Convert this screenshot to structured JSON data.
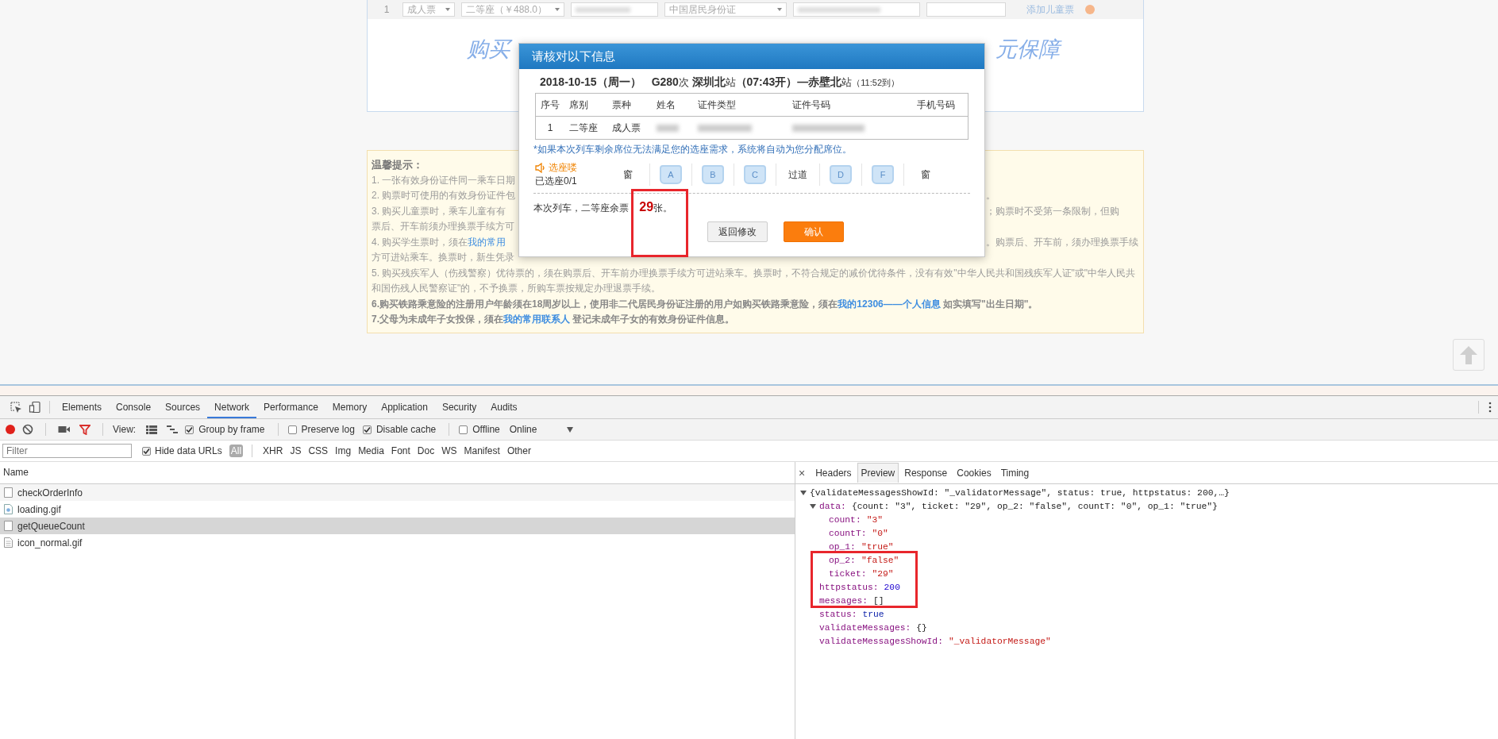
{
  "page": {
    "passenger_row": {
      "index": "1",
      "ticket_type": "成人票",
      "seat_class": "二等座（￥488.0）",
      "id_type": "中国居民身份证",
      "add_child": "添加儿童票"
    },
    "banner": {
      "left": "购买",
      "right": "元保障"
    },
    "tips": {
      "title": "温馨提示：",
      "lines": [
        {
          "kind": "split",
          "left": [
            {
              "text": "1. 一张有效身份证件同一乘车日期"
            }
          ]
        },
        {
          "kind": "split",
          "left": [
            {
              "text": "2. 购票时可使用的有效身份证件包"
            }
          ],
          "right": "。"
        },
        {
          "kind": "split",
          "left": [
            {
              "text": "3. 购买儿童票时，乘车儿童有有"
            }
          ],
          "right": "；购票时不受第一条限制，但购"
        },
        {
          "kind": "split",
          "left": [
            {
              "text": "票后、开车前须办理换票手续方可"
            }
          ]
        },
        {
          "kind": "split",
          "left": [
            {
              "text": "4. 购买学生票时，须在"
            },
            {
              "text": "我的常用",
              "link": true
            }
          ],
          "right": "。购票后、开车前，须办理换票手续"
        },
        {
          "kind": "para",
          "bold": false,
          "segments": [
            {
              "text": "方可进站乘车。换票时，新生凭录"
            }
          ]
        },
        {
          "kind": "para",
          "bold": false,
          "segments": [
            {
              "text": "5. 购买残疾军人（伤残警察）优待票的，须在购票后、开车前办理换票手续方可进站乘车。换票时，不符合规定的减价优待条件，没有有效\"中华人民共和国残疾军人证\"或\"中华人民共和国伤残人民警察证\"的，不予换票，所购车票按规定办理退票手续。"
            }
          ]
        },
        {
          "kind": "para",
          "bold": true,
          "segments": [
            {
              "text": "6.购买铁路乘意险的注册用户年龄须在18周岁以上，使用非二代居民身份证注册的用户如购买铁路乘意险，须在"
            },
            {
              "text": "我的12306——个人信息",
              "link": true
            },
            {
              "text": " 如实填写\"出生日期\"。"
            }
          ]
        },
        {
          "kind": "para",
          "bold": true,
          "segments": [
            {
              "text": "7.父母为未成年子女投保，须在"
            },
            {
              "text": "我的常用联系人",
              "link": true
            },
            {
              "text": " 登记未成年子女的有效身份证件信息。"
            }
          ]
        }
      ]
    }
  },
  "dialog": {
    "title": "请核对以下信息",
    "train": "**2018-10-15（周一）**　**G280**次 **深圳北**站**（07:43开）—赤壁北**站",
    "arrival": "（11:52到）",
    "columns": [
      "序号",
      "席别",
      "票种",
      "姓名",
      "证件类型",
      "证件号码",
      "手机号码"
    ],
    "rows": [
      {
        "cells": [
          {
            "kind": "text",
            "text": "1"
          },
          {
            "kind": "text",
            "text": "二等座"
          },
          {
            "kind": "text",
            "text": "成人票"
          },
          {
            "kind": "blurred"
          },
          {
            "kind": "blurred"
          },
          {
            "kind": "blurred"
          }
        ]
      }
    ],
    "note": "*如果本次列车剩余席位无法满足您的选座需求，系统将自动为您分配席位。",
    "seat_pick": {
      "label": "选座喽",
      "count": "已选座0/1",
      "seats": [
        {
          "kind": "label",
          "text": "窗"
        },
        {
          "kind": "seat",
          "text": "A",
          "selected": false
        },
        {
          "kind": "seat",
          "text": "B",
          "selected": false
        },
        {
          "kind": "seat",
          "text": "C",
          "selected": false
        },
        {
          "kind": "label",
          "text": "过道"
        },
        {
          "kind": "seat",
          "text": "D",
          "selected": false
        },
        {
          "kind": "seat",
          "text": "F",
          "selected": false
        },
        {
          "kind": "label",
          "text": "窗"
        }
      ]
    },
    "remaining": "本次列车，二等座余票 **29**张。",
    "buttons": [
      {
        "kind": "secondary",
        "label": "返回修改"
      },
      {
        "kind": "primary",
        "label": "确认"
      }
    ]
  },
  "devtools": {
    "tabs": [
      {
        "label": "Elements",
        "selected": false
      },
      {
        "label": "Console",
        "selected": false
      },
      {
        "label": "Sources",
        "selected": false
      },
      {
        "label": "Network",
        "selected": true
      },
      {
        "label": "Performance",
        "selected": false
      },
      {
        "label": "Memory",
        "selected": false
      },
      {
        "label": "Application",
        "selected": false
      },
      {
        "label": "Security",
        "selected": false
      },
      {
        "label": "Audits",
        "selected": false
      }
    ],
    "recording": true,
    "filter_shown": true,
    "view_label": "View:",
    "options": [
      {
        "label": "Group by frame",
        "checked": true
      },
      {
        "label": "Preserve log",
        "checked": false
      },
      {
        "label": "Disable cache",
        "checked": true
      },
      {
        "label": "Offline",
        "checked": false
      }
    ],
    "throttle": "Online",
    "filter": {
      "placeholder": "Filter"
    },
    "hide_data_urls": {
      "label": "Hide data URLs",
      "checked": true
    },
    "types": [
      {
        "label": "All",
        "selected": true
      },
      {
        "label": "XHR",
        "selected": false
      },
      {
        "label": "JS",
        "selected": false
      },
      {
        "label": "CSS",
        "selected": false
      },
      {
        "label": "Img",
        "selected": false
      },
      {
        "label": "Media",
        "selected": false
      },
      {
        "label": "Font",
        "selected": false
      },
      {
        "label": "Doc",
        "selected": false
      },
      {
        "label": "WS",
        "selected": false
      },
      {
        "label": "Manifest",
        "selected": false
      },
      {
        "label": "Other",
        "selected": false
      }
    ],
    "column": "Name",
    "requests": [
      {
        "name": "checkOrderInfo",
        "kind": "document",
        "selected": false
      },
      {
        "name": "loading.gif",
        "kind": "image",
        "selected": false
      },
      {
        "name": "getQueueCount",
        "kind": "document",
        "selected": true
      },
      {
        "name": "icon_normal.gif",
        "kind": "file",
        "selected": false
      }
    ],
    "close": "×",
    "detail_tabs": [
      {
        "label": "Headers",
        "selected": false
      },
      {
        "label": "Preview",
        "selected": true
      },
      {
        "label": "Response",
        "selected": false
      },
      {
        "label": "Cookies",
        "selected": false
      },
      {
        "label": "Timing",
        "selected": false
      }
    ],
    "tree": [
      {
        "value": "{validateMessagesShowId: \"_validatorMessage\", status: true, httpstatus: 200,…}",
        "kind": "summary",
        "expanded": true,
        "children": [
          {
            "key": "data:",
            "value": "{count: \"3\", ticket: \"29\", op_2: \"false\", countT: \"0\", op_1: \"true\"}",
            "kind": "summary",
            "expanded": true,
            "children": [
              {
                "key": "count:",
                "value": "\"3\"",
                "kind": "string"
              },
              {
                "key": "countT:",
                "value": "\"0\"",
                "kind": "string"
              },
              {
                "key": "op_1:",
                "value": "\"true\"",
                "kind": "string"
              },
              {
                "key": "op_2:",
                "value": "\"false\"",
                "kind": "string"
              },
              {
                "key": "ticket:",
                "value": "\"29\"",
                "kind": "string"
              }
            ]
          },
          {
            "key": "httpstatus:",
            "value": "200",
            "kind": "number"
          },
          {
            "key": "messages:",
            "value": "[]",
            "kind": "object"
          },
          {
            "key": "status:",
            "value": "true",
            "kind": "bool"
          },
          {
            "key": "validateMessages:",
            "value": "{}",
            "kind": "object"
          },
          {
            "key": "validateMessagesShowId:",
            "value": "\"_validatorMessage\"",
            "kind": "string"
          }
        ]
      }
    ]
  }
}
